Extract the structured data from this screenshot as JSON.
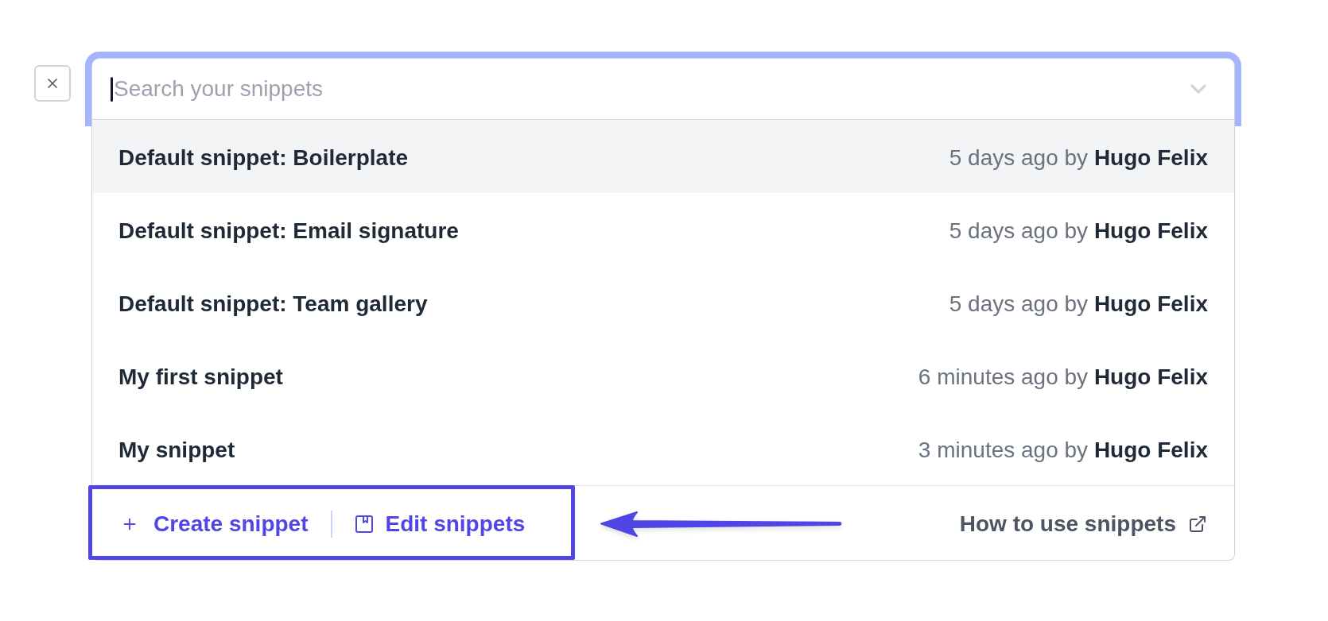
{
  "search": {
    "placeholder": "Search your snippets",
    "focused": true
  },
  "snippets": [
    {
      "title": "Default snippet: Boilerplate",
      "meta": "5 days ago by **Hugo Felix**",
      "selected": true
    },
    {
      "title": "Default snippet: Email signature",
      "meta": "5 days ago by **Hugo Felix**",
      "selected": false
    },
    {
      "title": "Default snippet: Team gallery",
      "meta": "5 days ago by **Hugo Felix**",
      "selected": false
    },
    {
      "title": "My first snippet",
      "meta": "6 minutes ago by **Hugo Felix**",
      "selected": false
    },
    {
      "title": "My snippet",
      "meta": "3 minutes ago by **Hugo Felix**",
      "selected": false
    }
  ],
  "footer": {
    "highlighted": true,
    "actions": [
      {
        "kind": "create",
        "label": "Create snippet"
      },
      {
        "kind": "edit",
        "label": "Edit snippets"
      }
    ],
    "help_link": {
      "label": "How to use snippets"
    }
  }
}
